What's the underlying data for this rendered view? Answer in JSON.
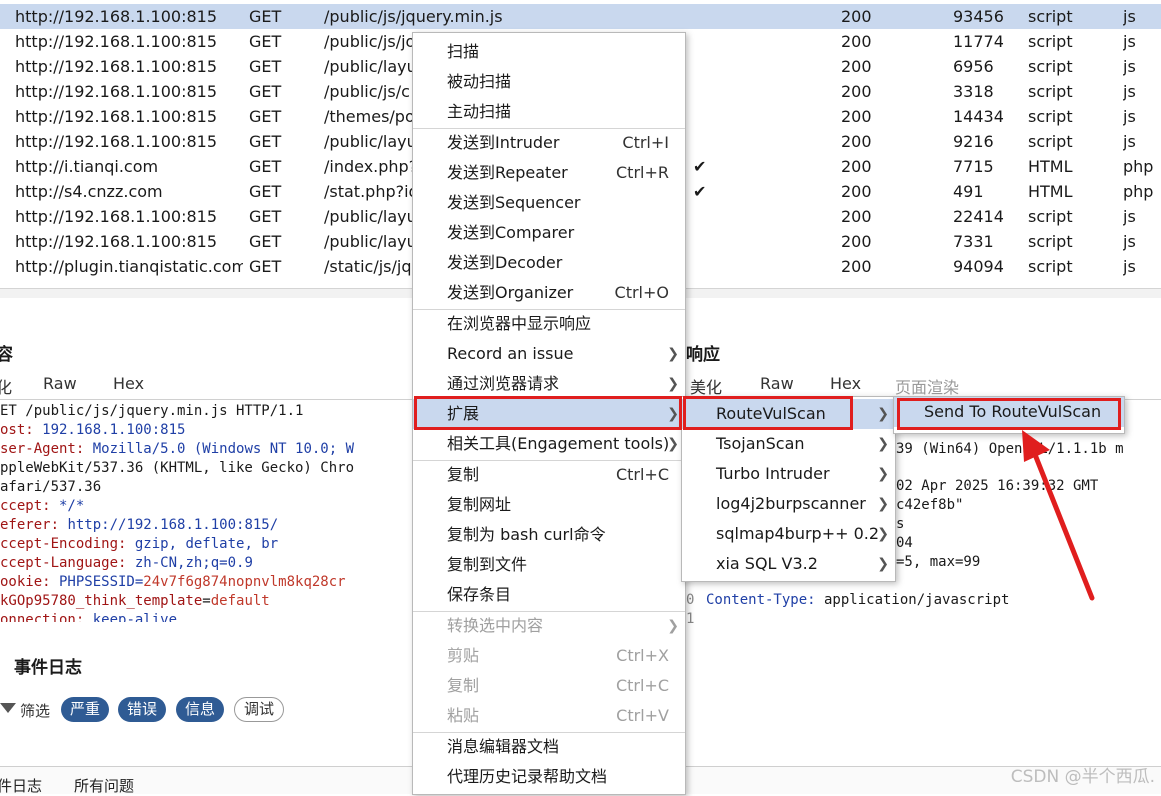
{
  "history": {
    "rows": [
      {
        "host": "http://192.168.1.100:815",
        "method": "GET",
        "url": "/public/js/jquery.min.js",
        "check": "",
        "status": "200",
        "length": "93456",
        "mime": "script",
        "ext": "js",
        "selected": true
      },
      {
        "host": "http://192.168.1.100:815",
        "method": "GET",
        "url": "/public/js/jo",
        "check": "",
        "status": "200",
        "length": "11774",
        "mime": "script",
        "ext": "js"
      },
      {
        "host": "http://192.168.1.100:815",
        "method": "GET",
        "url": "/public/layu",
        "check": "",
        "status": "200",
        "length": "6956",
        "mime": "script",
        "ext": "js"
      },
      {
        "host": "http://192.168.1.100:815",
        "method": "GET",
        "url": "/public/js/c",
        "check": "",
        "status": "200",
        "length": "3318",
        "mime": "script",
        "ext": "js"
      },
      {
        "host": "http://192.168.1.100:815",
        "method": "GET",
        "url": "/themes/po",
        "check": "",
        "status": "200",
        "length": "14434",
        "mime": "script",
        "ext": "js"
      },
      {
        "host": "http://192.168.1.100:815",
        "method": "GET",
        "url": "/public/layu",
        "check": "",
        "status": "200",
        "length": "9216",
        "mime": "script",
        "ext": "js"
      },
      {
        "host": "http://i.tianqi.com",
        "method": "GET",
        "url": "/index.php?",
        "check": "✔",
        "status": "200",
        "length": "7715",
        "mime": "HTML",
        "ext": "php"
      },
      {
        "host": "http://s4.cnzz.com",
        "method": "GET",
        "url": "/stat.php?id",
        "check": "✔",
        "status": "200",
        "length": "491",
        "mime": "HTML",
        "ext": "php"
      },
      {
        "host": "http://192.168.1.100:815",
        "method": "GET",
        "url": "/public/layu",
        "check": "",
        "status": "200",
        "length": "22414",
        "mime": "script",
        "ext": "js"
      },
      {
        "host": "http://192.168.1.100:815",
        "method": "GET",
        "url": "/public/layu",
        "check": "",
        "status": "200",
        "length": "7331",
        "mime": "script",
        "ext": "js"
      },
      {
        "host": "http://plugin.tianqistatic.com",
        "method": "GET",
        "url": "/static/js/jq",
        "check": "",
        "status": "200",
        "length": "94094",
        "mime": "script",
        "ext": "js"
      }
    ]
  },
  "request": {
    "title_fragment": "容",
    "tabs": [
      "化",
      "Raw",
      "Hex"
    ],
    "lines": [
      {
        "text": "ET /public/js/jquery.min.js HTTP/1.1"
      },
      {
        "key": "ost:",
        "value": " 192.168.1.100:815"
      },
      {
        "key": "ser-Agent:",
        "value": " Mozilla/5.0 (Windows NT 10.0; W"
      },
      {
        "text": "ppleWebKit/537.36 (KHTML, like Gecko) Chro"
      },
      {
        "text": "afari/537.36"
      },
      {
        "key": "ccept:",
        "value": " */*"
      },
      {
        "key": "eferer:",
        "value": " http://192.168.1.100:815/"
      },
      {
        "key": "ccept-Encoding:",
        "value": " gzip, deflate, br"
      },
      {
        "key": "ccept-Language:",
        "value": " zh-CN,zh;q=0.9"
      },
      {
        "key": "ookie:",
        "value": " PHPSESSID=",
        "value2": "24v7f6g874nopnvlm8kq28cr"
      },
      {
        "text_blue": "kGOp95780_think_template",
        "eq": "=",
        "value2": "default"
      },
      {
        "key": "onnection:",
        "value": " keep-alive"
      }
    ]
  },
  "response": {
    "title": "响应",
    "tabs": [
      "美化",
      "Raw",
      "Hex",
      "页面渲染"
    ],
    "lines": [
      "39 (Win64) OpenSSL/1.1.1b m",
      "02 Apr 2025 16:39:32 GMT",
      "c42ef8b\"",
      "s",
      "04",
      "=5, max=99"
    ],
    "content_type_key": "Content-Type:",
    "content_type_value": " application/javascript",
    "gutter": [
      "0",
      "1"
    ]
  },
  "event_log": {
    "title": "事件日志",
    "filter_label": "筛选",
    "filters": [
      "严重",
      "错误",
      "信息",
      "调试"
    ]
  },
  "bottom_tabs": [
    "件日志",
    "所有问题"
  ],
  "watermark": "CSDN @半个西瓜.",
  "context_menu": {
    "items": [
      {
        "label": "扫描"
      },
      {
        "label": "被动扫描"
      },
      {
        "label": "主动扫描"
      },
      {
        "label": "发送到Intruder",
        "shortcut": "Ctrl+I"
      },
      {
        "label": "发送到Repeater",
        "shortcut": "Ctrl+R"
      },
      {
        "label": "发送到Sequencer"
      },
      {
        "label": "发送到Comparer"
      },
      {
        "label": "发送到Decoder"
      },
      {
        "label": "发送到Organizer",
        "shortcut": "Ctrl+O"
      },
      {
        "label": "在浏览器中显示响应"
      },
      {
        "label": "Record an issue",
        "submenu": true
      },
      {
        "label": "通过浏览器请求",
        "submenu": true
      },
      {
        "label": "扩展",
        "submenu": true,
        "highlighted": true
      },
      {
        "label": "相关工具(Engagement tools)",
        "submenu": true
      },
      {
        "label": "复制",
        "shortcut": "Ctrl+C"
      },
      {
        "label": "复制网址"
      },
      {
        "label": "复制为 bash curl命令"
      },
      {
        "label": "复制到文件"
      },
      {
        "label": "保存条目"
      },
      {
        "label": "转换选中内容",
        "submenu": true,
        "disabled": true
      },
      {
        "label": "剪贴",
        "shortcut": "Ctrl+X",
        "disabled": true
      },
      {
        "label": "复制",
        "shortcut": "Ctrl+C",
        "disabled": true
      },
      {
        "label": "粘贴",
        "shortcut": "Ctrl+V",
        "disabled": true
      },
      {
        "label": "消息编辑器文档"
      },
      {
        "label": "代理历史记录帮助文档"
      }
    ]
  },
  "extensions_menu": {
    "items": [
      {
        "label": "RouteVulScan",
        "submenu": true,
        "highlighted": true
      },
      {
        "label": "TsojanScan",
        "submenu": true
      },
      {
        "label": "Turbo Intruder",
        "submenu": true
      },
      {
        "label": "log4j2burpscanner",
        "submenu": true
      },
      {
        "label": "sqlmap4burp++ 0.2",
        "submenu": true
      },
      {
        "label": "xia SQL V3.2",
        "submenu": true
      }
    ]
  },
  "routevulscan_menu": {
    "items": [
      {
        "label": "Send To RouteVulScan",
        "highlighted": true
      }
    ]
  },
  "colors": {
    "highlight": "#c9d8ee",
    "annotation": "#e01e1e",
    "pill": "#2f5b94"
  }
}
